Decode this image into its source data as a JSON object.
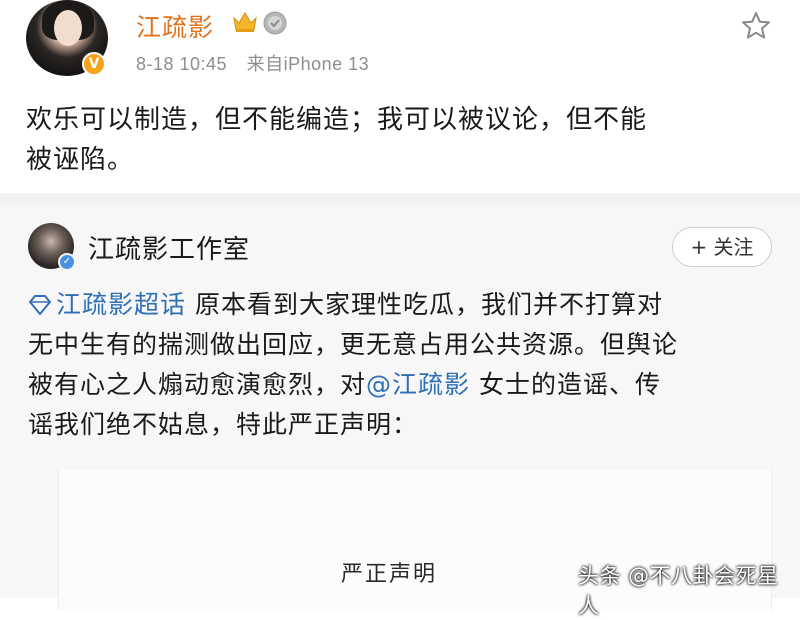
{
  "post": {
    "author": "江疏影",
    "avatar_badge": "V",
    "meta": {
      "date": "8-18 10:45",
      "source": "来自iPhone 13"
    },
    "text_line1": "欢乐可以制造，但不能编造；我可以被议论，但不能",
    "text_line2": "被诬陷。"
  },
  "repost": {
    "author": "江疏影工作室",
    "follow_label": "+ 关注",
    "topic": "江疏影超话",
    "line1_rest": " 原本看到大家理性吃瓜，我们并不打算对",
    "line2": "无中生有的揣测做出回应，更无意占用公共资源。但舆论",
    "line3_start": "被有心之人煽动愈演愈烈，对",
    "mention": "@江疏影",
    "line3_end": " 女士的造谣、传",
    "line4": "谣我们绝不姑息，特此严正声明："
  },
  "document": {
    "title": "严正声明"
  },
  "watermark": "头条 @不八卦会死星人",
  "colors": {
    "author_name": "#e2731d",
    "link": "#2e6fb6",
    "meta": "#8e8e8e"
  },
  "icons": [
    "crown-icon",
    "medal-icon",
    "star-icon",
    "verified-icon",
    "super-topic-diamond-icon"
  ]
}
